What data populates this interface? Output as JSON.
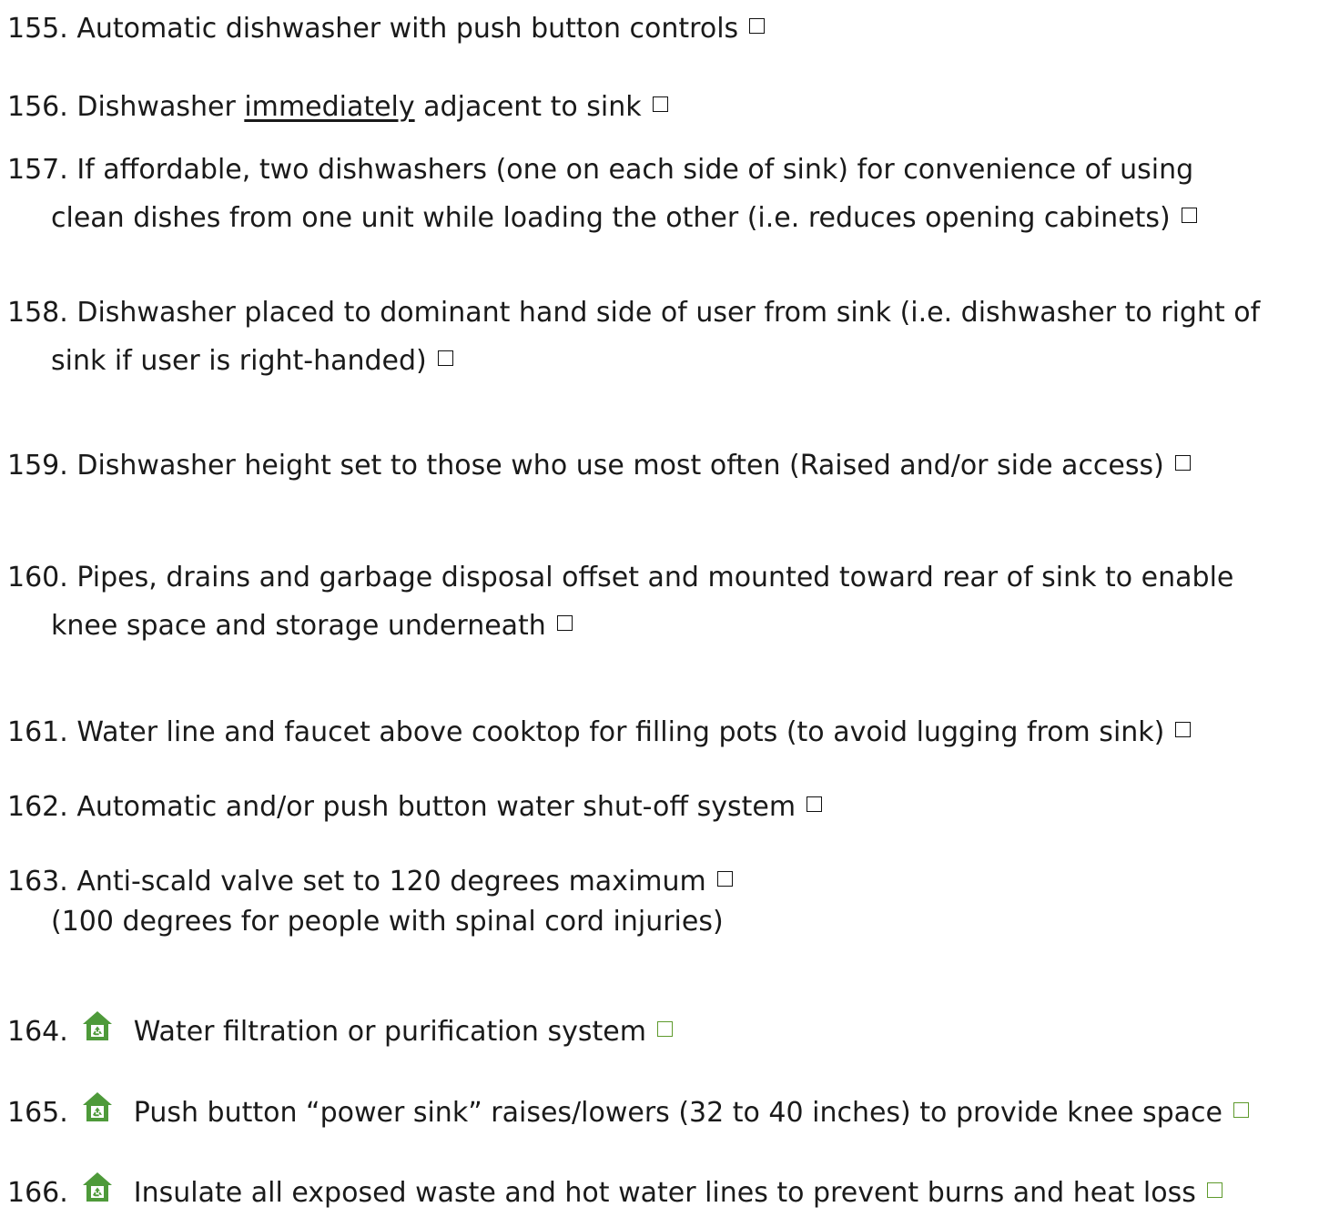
{
  "items": [
    {
      "num": "155.",
      "text": "Automatic dishwasher with push button controls"
    },
    {
      "num": "156.",
      "before": "Dishwasher ",
      "underlined": "immediately",
      "after": " adjacent to sink"
    },
    {
      "num": "157.",
      "text": "If affordable, two dishwashers (one on each side of sink) for convenience of using",
      "text2": "clean dishes from one unit while loading the other (i.e. reduces opening cabinets)"
    },
    {
      "num": "158.",
      "text": "Dishwasher placed to dominant hand side of user from sink (i.e. dishwasher to right of",
      "text2": "sink if user is right-handed)"
    },
    {
      "num": "159.",
      "text": "Dishwasher height set to those who use most often (Raised and/or side access)"
    },
    {
      "num": "160.",
      "text": "Pipes, drains and garbage disposal offset and mounted toward rear of sink to enable",
      "text2": "knee space and storage underneath"
    },
    {
      "num": "161.",
      "text": "Water line and faucet above cooktop for filling pots (to avoid lugging from sink)"
    },
    {
      "num": "162.",
      "text": "Automatic and/or push button water shut-off system"
    },
    {
      "num": "163.",
      "text": "Anti-scald valve set to 120 degrees maximum",
      "text2": "(100 degrees for people with spinal cord injuries)"
    },
    {
      "num": "164.",
      "text": "Water filtration or purification system",
      "icon": "green-home-recycle-icon"
    },
    {
      "num": "165.",
      "text": "Push button “power sink” raises/lowers (32 to 40 inches) to provide knee space",
      "icon": "green-home-recycle-icon"
    },
    {
      "num": "166.",
      "text": "Insulate all exposed waste and hot water lines to prevent burns and heat loss",
      "icon": "green-home-recycle-icon"
    }
  ],
  "colors": {
    "text": "#1a1a1a",
    "checkbox": "#111111",
    "green_checkbox": "#5e9a2c",
    "icon_green": "#4e9a3a"
  }
}
